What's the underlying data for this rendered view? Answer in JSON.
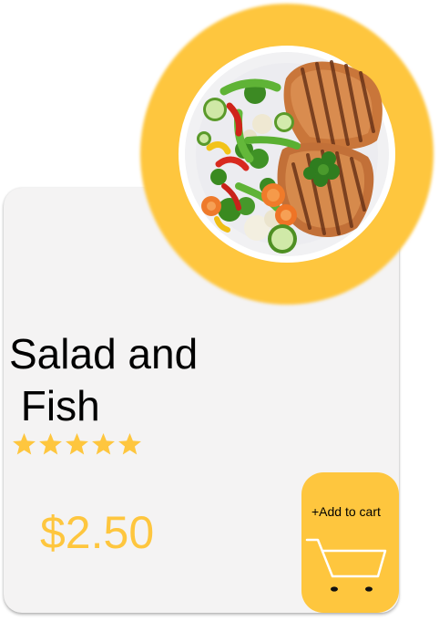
{
  "product": {
    "name": "Salad and\n Fish",
    "rating": 5,
    "rating_max": 5,
    "price": "$2.50",
    "image_icon": "salad-and-fish-plate"
  },
  "cart_button": {
    "label": "+Add to cart",
    "icon": "shopping-cart-icon"
  },
  "colors": {
    "accent": "#fec63e",
    "card_background": "#f4f3f3",
    "text": "#000000",
    "star": "#fec63e"
  }
}
